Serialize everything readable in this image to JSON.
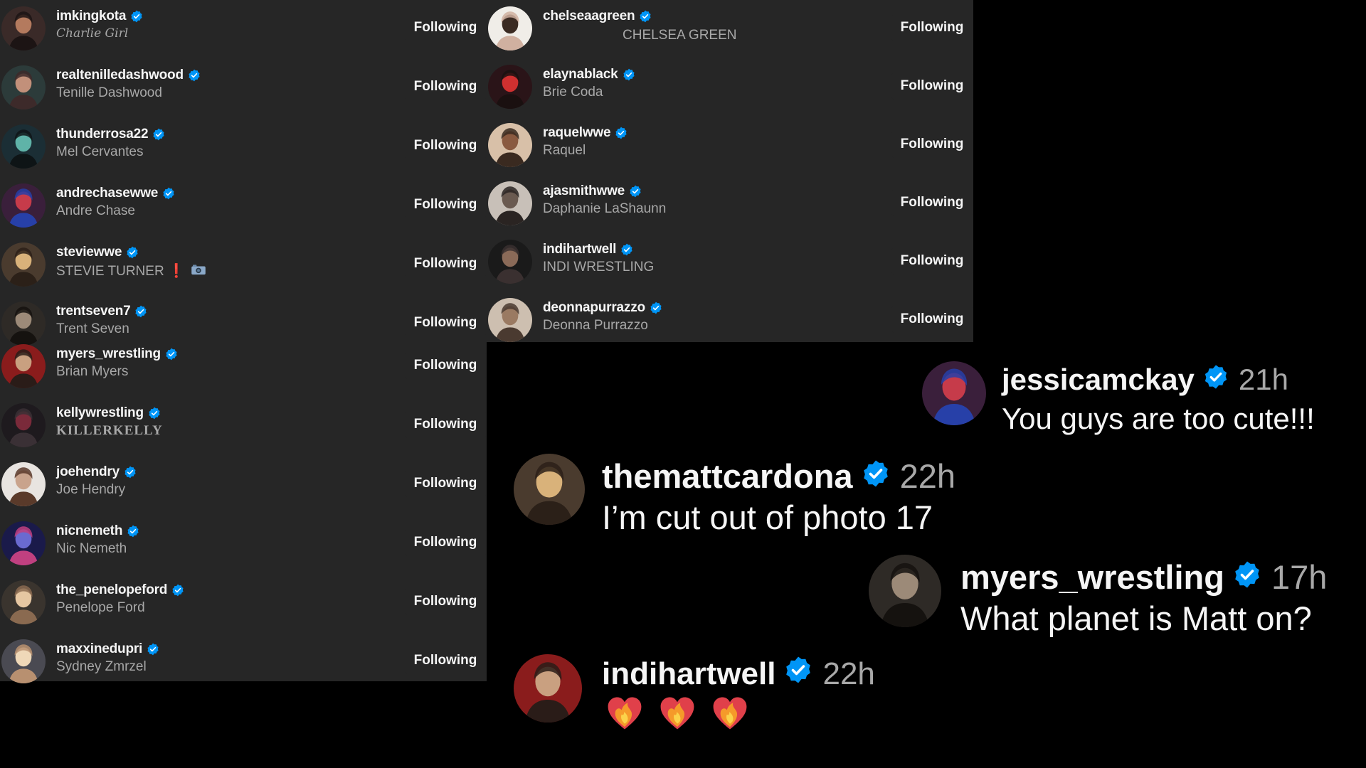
{
  "following_label": "Following",
  "left_list": [
    {
      "username": "imkingkota",
      "display_name": "Charlie Girl",
      "style": "gothic"
    },
    {
      "username": "realtenilledashwood",
      "display_name": "Tenille Dashwood"
    },
    {
      "username": "thunderrosa22",
      "display_name": "Mel Cervantes"
    },
    {
      "username": "andrechasewwe",
      "display_name": "Andre Chase"
    },
    {
      "username": "steviewwe",
      "display_name": "STEVIE TURNER ❗"
    },
    {
      "username": "trentseven7",
      "display_name": "Trent Seven"
    },
    {
      "username": "myers_wrestling",
      "display_name": "Brian Myers"
    },
    {
      "username": "kellywrestling",
      "display_name": "KILLERKELLY",
      "style": "serifbold"
    },
    {
      "username": "joehendry",
      "display_name": "Joe Hendry"
    },
    {
      "username": "nicnemeth",
      "display_name": "Nic Nemeth"
    },
    {
      "username": "the_penelopeford",
      "display_name": "Penelope Ford"
    },
    {
      "username": "maxxinedupri",
      "display_name": "Sydney Zmrzel"
    }
  ],
  "right_list": [
    {
      "username": "chelseaagreen",
      "display_name": "CHELSEA GREEN",
      "style": "indent"
    },
    {
      "username": "elaynablack",
      "display_name": "Brie Coda"
    },
    {
      "username": "raquelwwe",
      "display_name": "Raquel"
    },
    {
      "username": "ajasmithwwe",
      "display_name": "Daphanie LaShaunn"
    },
    {
      "username": "indihartwell",
      "display_name": "INDI WRESTLING"
    },
    {
      "username": "deonnapurrazzo",
      "display_name": "Deonna Purrazzo"
    }
  ],
  "comments": [
    {
      "username": "jessicamckay",
      "time": "21h",
      "text": "You guys are too cute!!!"
    },
    {
      "username": "themattcardona",
      "time": "22h",
      "text": "I’m cut out of photo 17"
    },
    {
      "username": "myers_wrestling",
      "time": "17h",
      "text": "What planet is Matt on?"
    },
    {
      "username": "indihartwell",
      "time": "22h",
      "text": ""
    }
  ],
  "colors": {
    "panel_bg": "#262626",
    "page_bg": "#000000",
    "verified_blue": "#0095f6",
    "secondary_text": "#a8a8a8"
  },
  "icons": {
    "verified": "verified-badge-icon",
    "camera": "camera-emoji-icon",
    "heart": "heart-on-fire-emoji-icon"
  }
}
